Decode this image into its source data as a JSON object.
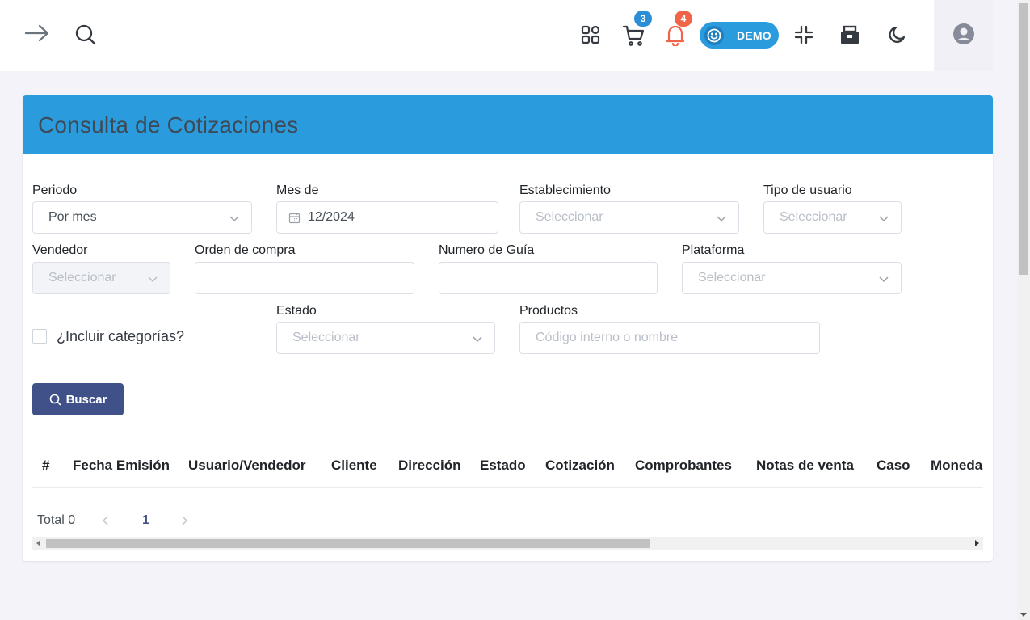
{
  "topbar": {
    "cart_badge": "3",
    "notifications_badge": "4",
    "demo_label": "DEMO"
  },
  "card": {
    "title": "Consulta de Cotizaciones"
  },
  "filters": {
    "periodo": {
      "label": "Periodo",
      "value": "Por mes"
    },
    "mes": {
      "label": "Mes de",
      "value": "12/2024"
    },
    "establecimiento": {
      "label": "Establecimiento",
      "placeholder": "Seleccionar"
    },
    "tipo_usuario": {
      "label": "Tipo de usuario",
      "placeholder": "Seleccionar"
    },
    "vendedor": {
      "label": "Vendedor",
      "placeholder": "Seleccionar"
    },
    "orden_compra": {
      "label": "Orden de compra",
      "value": ""
    },
    "numero_guia": {
      "label": "Numero de Guía",
      "value": ""
    },
    "plataforma": {
      "label": "Plataforma",
      "placeholder": "Seleccionar"
    },
    "incluir_categorias": {
      "label": "¿Incluir categorías?",
      "checked": false
    },
    "estado": {
      "label": "Estado",
      "placeholder": "Seleccionar"
    },
    "productos": {
      "label": "Productos",
      "placeholder": "Código interno o nombre"
    }
  },
  "buttons": {
    "buscar": "Buscar"
  },
  "table": {
    "columns": [
      "#",
      "Fecha Emisión",
      "Usuario/Vendedor",
      "Cliente",
      "Dirección",
      "Estado",
      "Cotización",
      "Comprobantes",
      "Notas de venta",
      "Caso",
      "Moneda"
    ]
  },
  "pagination": {
    "total_label": "Total 0",
    "current_page": "1"
  },
  "colors": {
    "header_blue": "#2a9bdc",
    "primary": "#405189",
    "badge_blue": "#2a8fd6",
    "badge_red": "#f06548"
  }
}
